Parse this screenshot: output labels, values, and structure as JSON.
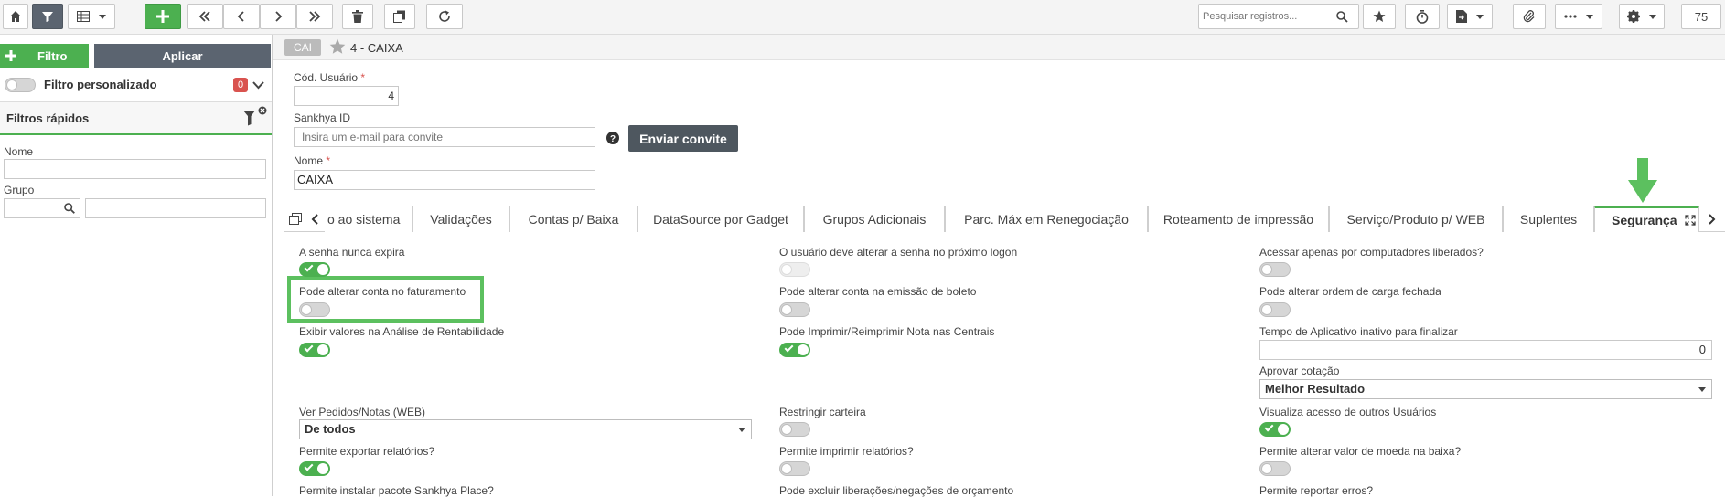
{
  "toolbar": {
    "search_placeholder": "Pesquisar registros...",
    "record_count": "75"
  },
  "filter_panel": {
    "filter_button": "Filtro",
    "apply_button": "Aplicar",
    "custom_filter_label": "Filtro personalizado",
    "custom_filter_count": "0",
    "quick_filters_title": "Filtros rápidos",
    "name_label": "Nome",
    "group_label": "Grupo"
  },
  "record": {
    "badge": "CAI",
    "title": "4 - CAIXA"
  },
  "form": {
    "cod_usuario_label": "Cód. Usuário",
    "cod_usuario_value": "4",
    "sankhya_id_label": "Sankhya ID",
    "sankhya_id_placeholder": "Insira um e-mail para convite",
    "invite_button": "Enviar convite",
    "nome_label": "Nome",
    "nome_value": "CAIXA",
    "required_mark": "*"
  },
  "tabs": [
    {
      "label": "o ao sistema"
    },
    {
      "label": "Validações"
    },
    {
      "label": "Contas p/ Baixa"
    },
    {
      "label": "DataSource por Gadget"
    },
    {
      "label": "Grupos Adicionais"
    },
    {
      "label": "Parc. Máx em Renegociação"
    },
    {
      "label": "Roteamento de impressão"
    },
    {
      "label": "Serviço/Produto p/ WEB"
    },
    {
      "label": "Suplentes"
    },
    {
      "label": "Segurança",
      "active": true
    }
  ],
  "security": {
    "col1": [
      {
        "label": "A senha nunca expira",
        "state": "on"
      },
      {
        "label": "Pode alterar conta no faturamento",
        "state": "off"
      },
      {
        "label": "Exibir valores na Análise de Rentabilidade",
        "state": "on"
      },
      {
        "label": "Ver Pedidos/Notas (WEB)",
        "select": "De todos"
      },
      {
        "label": "Permite exportar relatórios?",
        "state": "on"
      },
      {
        "label": "Permite instalar pacote Sankhya Place?"
      }
    ],
    "col2": [
      {
        "label": "O usuário deve alterar a senha no próximo logon",
        "state": "disabled"
      },
      {
        "label": "Pode alterar conta na emissão de boleto",
        "state": "off"
      },
      {
        "label": "Pode Imprimir/Reimprimir Nota nas Centrais",
        "state": "on"
      },
      {
        "label": "Restringir carteira",
        "state": "off"
      },
      {
        "label": "Permite imprimir relatórios?",
        "state": "off"
      },
      {
        "label": "Pode excluir liberações/negações de orçamento"
      }
    ],
    "col3": [
      {
        "label": "Acessar apenas por computadores liberados?",
        "state": "off"
      },
      {
        "label": "Pode alterar ordem de carga fechada",
        "state": "off"
      },
      {
        "label": "Tempo de Aplicativo inativo para finalizar",
        "value": "0"
      },
      {
        "label": "Aprovar cotação",
        "select": "Melhor Resultado"
      },
      {
        "label": "Visualiza acesso de outros Usuários",
        "state": "on"
      },
      {
        "label": "Permite alterar valor de moeda na baixa?",
        "state": "off"
      },
      {
        "label": "Permite reportar erros?"
      }
    ]
  },
  "colors": {
    "accent_green": "#4cb050",
    "dark_button": "#5b6470",
    "badge_red": "#d9534f",
    "highlight_box": "#5cc05f"
  }
}
